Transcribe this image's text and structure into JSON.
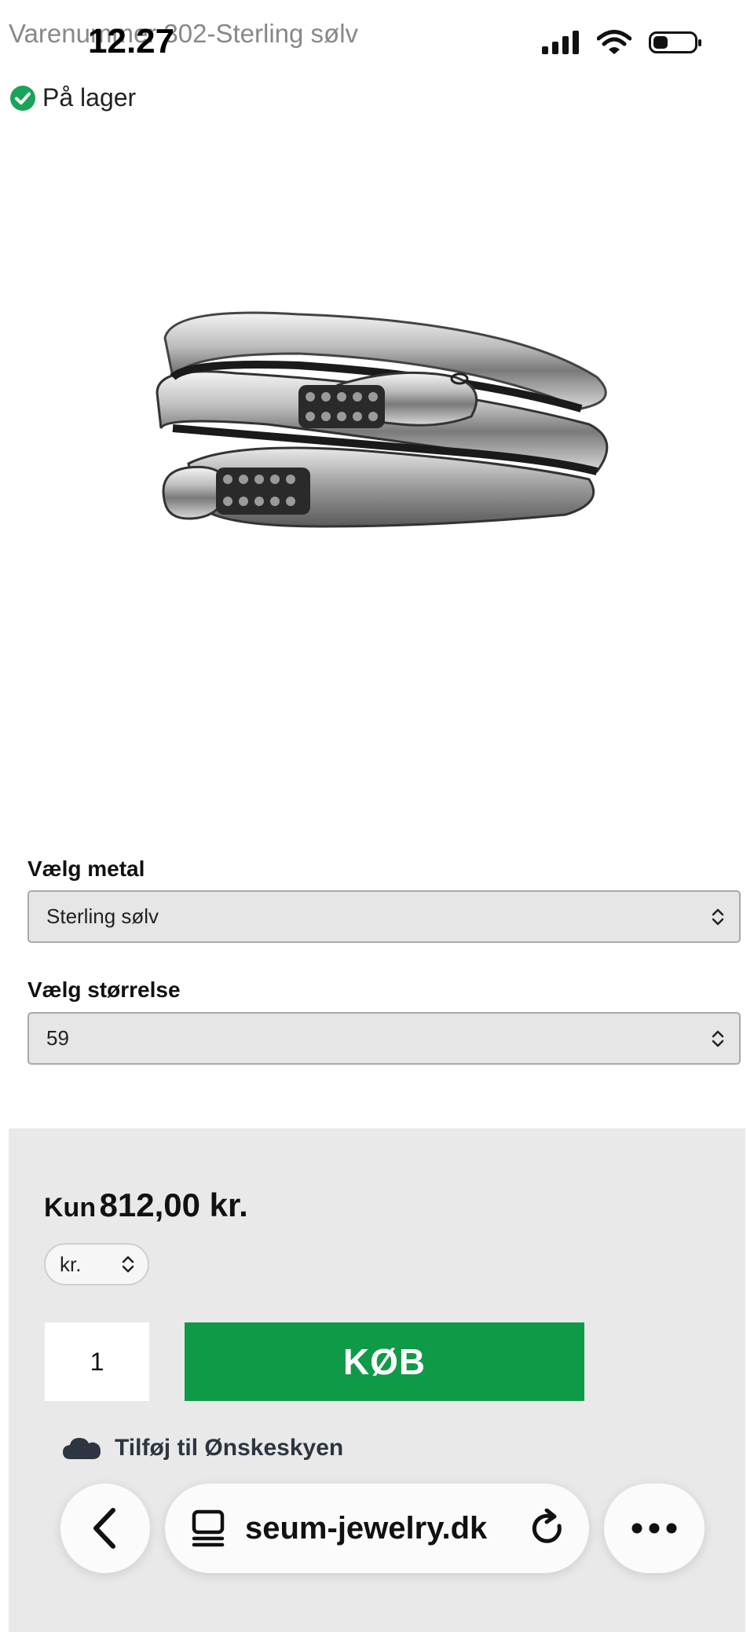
{
  "status_bar": {
    "time": "12.27",
    "sku_text": "Varenummer 302-Sterling sølv",
    "icons": [
      "cellular-signal-icon",
      "wifi-icon",
      "battery-icon"
    ]
  },
  "stock": {
    "label": "På lager",
    "color": "#1aa35a"
  },
  "product": {
    "image": "silver-snake-ring"
  },
  "metal": {
    "label": "Vælg metal",
    "value": "Sterling sølv"
  },
  "size": {
    "label": "Vælg størrelse",
    "value": "59"
  },
  "purchase": {
    "price_prefix": "Kun",
    "price": "812,00 kr.",
    "currency": "kr.",
    "quantity": "1",
    "buy_label": "KØB",
    "buy_color": "#0f9a48",
    "wishlist_label": "Tilføj til Ønskeskyen"
  },
  "browser": {
    "url": "seum-jewelry.dk",
    "icons": [
      "back-icon",
      "tabs-icon",
      "reload-icon",
      "more-icon"
    ]
  }
}
